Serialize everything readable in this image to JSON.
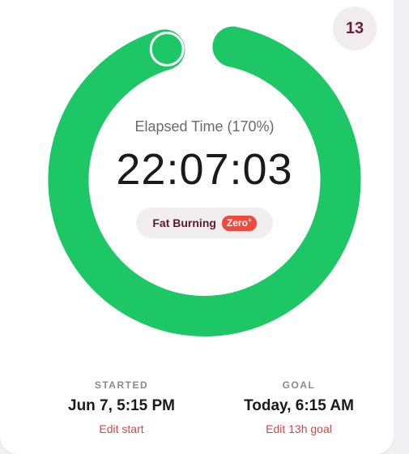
{
  "day_badge": {
    "value": "13"
  },
  "progress": {
    "percent": 170,
    "ring_color": "#1ec765",
    "knob_color": "#1ec765"
  },
  "elapsed": {
    "label": "Elapsed Time (170%)",
    "time": "22:07:03"
  },
  "stage": {
    "label": "Fat Burning",
    "badge_text": "Zero",
    "badge_sup": "+"
  },
  "started": {
    "heading": "STARTED",
    "value": "Jun 7, 5:15 PM",
    "edit_label": "Edit start"
  },
  "goal": {
    "heading": "GOAL",
    "value": "Today, 6:15 AM",
    "edit_label": "Edit 13h goal"
  },
  "colors": {
    "accent_red": "#d9463a",
    "brand_maroon": "#6b1d3a"
  }
}
